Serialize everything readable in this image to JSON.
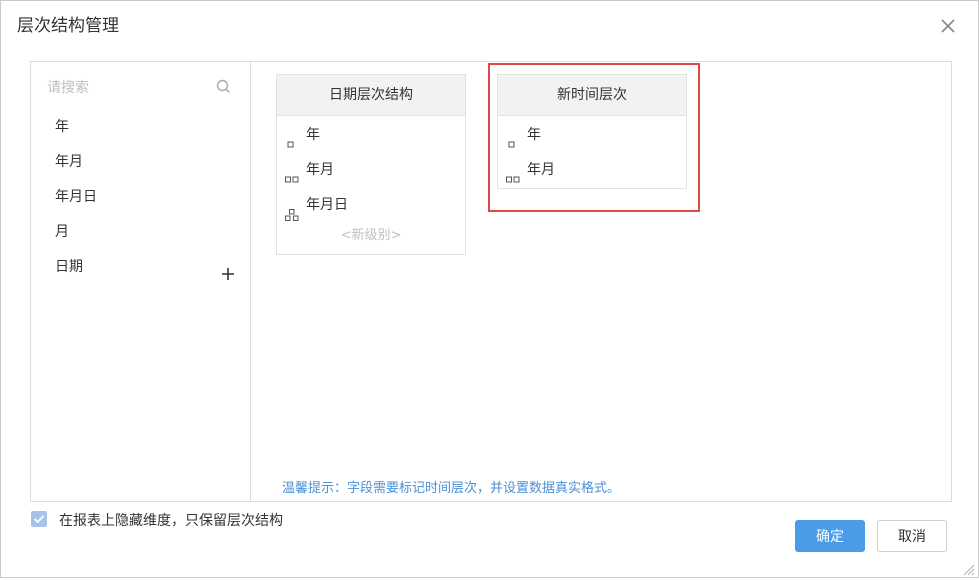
{
  "dialog": {
    "title": "层次结构管理",
    "close_icon": "close-icon"
  },
  "search": {
    "placeholder": "请搜索",
    "icon": "search-icon"
  },
  "fields": [
    {
      "label": "年"
    },
    {
      "label": "年月"
    },
    {
      "label": "年月日"
    },
    {
      "label": "月"
    },
    {
      "label": "日期",
      "action_icon": "plus-icon"
    }
  ],
  "hierarchies": [
    {
      "title": "日期层次结构",
      "levels": [
        {
          "label": "年",
          "icon": "level-1-icon"
        },
        {
          "label": "年月",
          "icon": "level-2-icon"
        },
        {
          "label": "年月日",
          "icon": "level-3-icon"
        }
      ],
      "new_level_label": "<新级别>"
    },
    {
      "title": "新时间层次",
      "levels": [
        {
          "label": "年",
          "icon": "level-1-icon"
        },
        {
          "label": "年月",
          "icon": "level-2-icon"
        }
      ]
    }
  ],
  "tip": "温馨提示：字段需要标记时间层次，并设置数据真实格式。",
  "option": {
    "checked": true,
    "label": "在报表上隐藏维度，只保留层次结构"
  },
  "buttons": {
    "ok": "确定",
    "cancel": "取消"
  },
  "colors": {
    "primary": "#4a9be8",
    "highlight_border": "#e04848",
    "tip_text": "#4a90d9",
    "header_bg": "#f2f2f2"
  }
}
